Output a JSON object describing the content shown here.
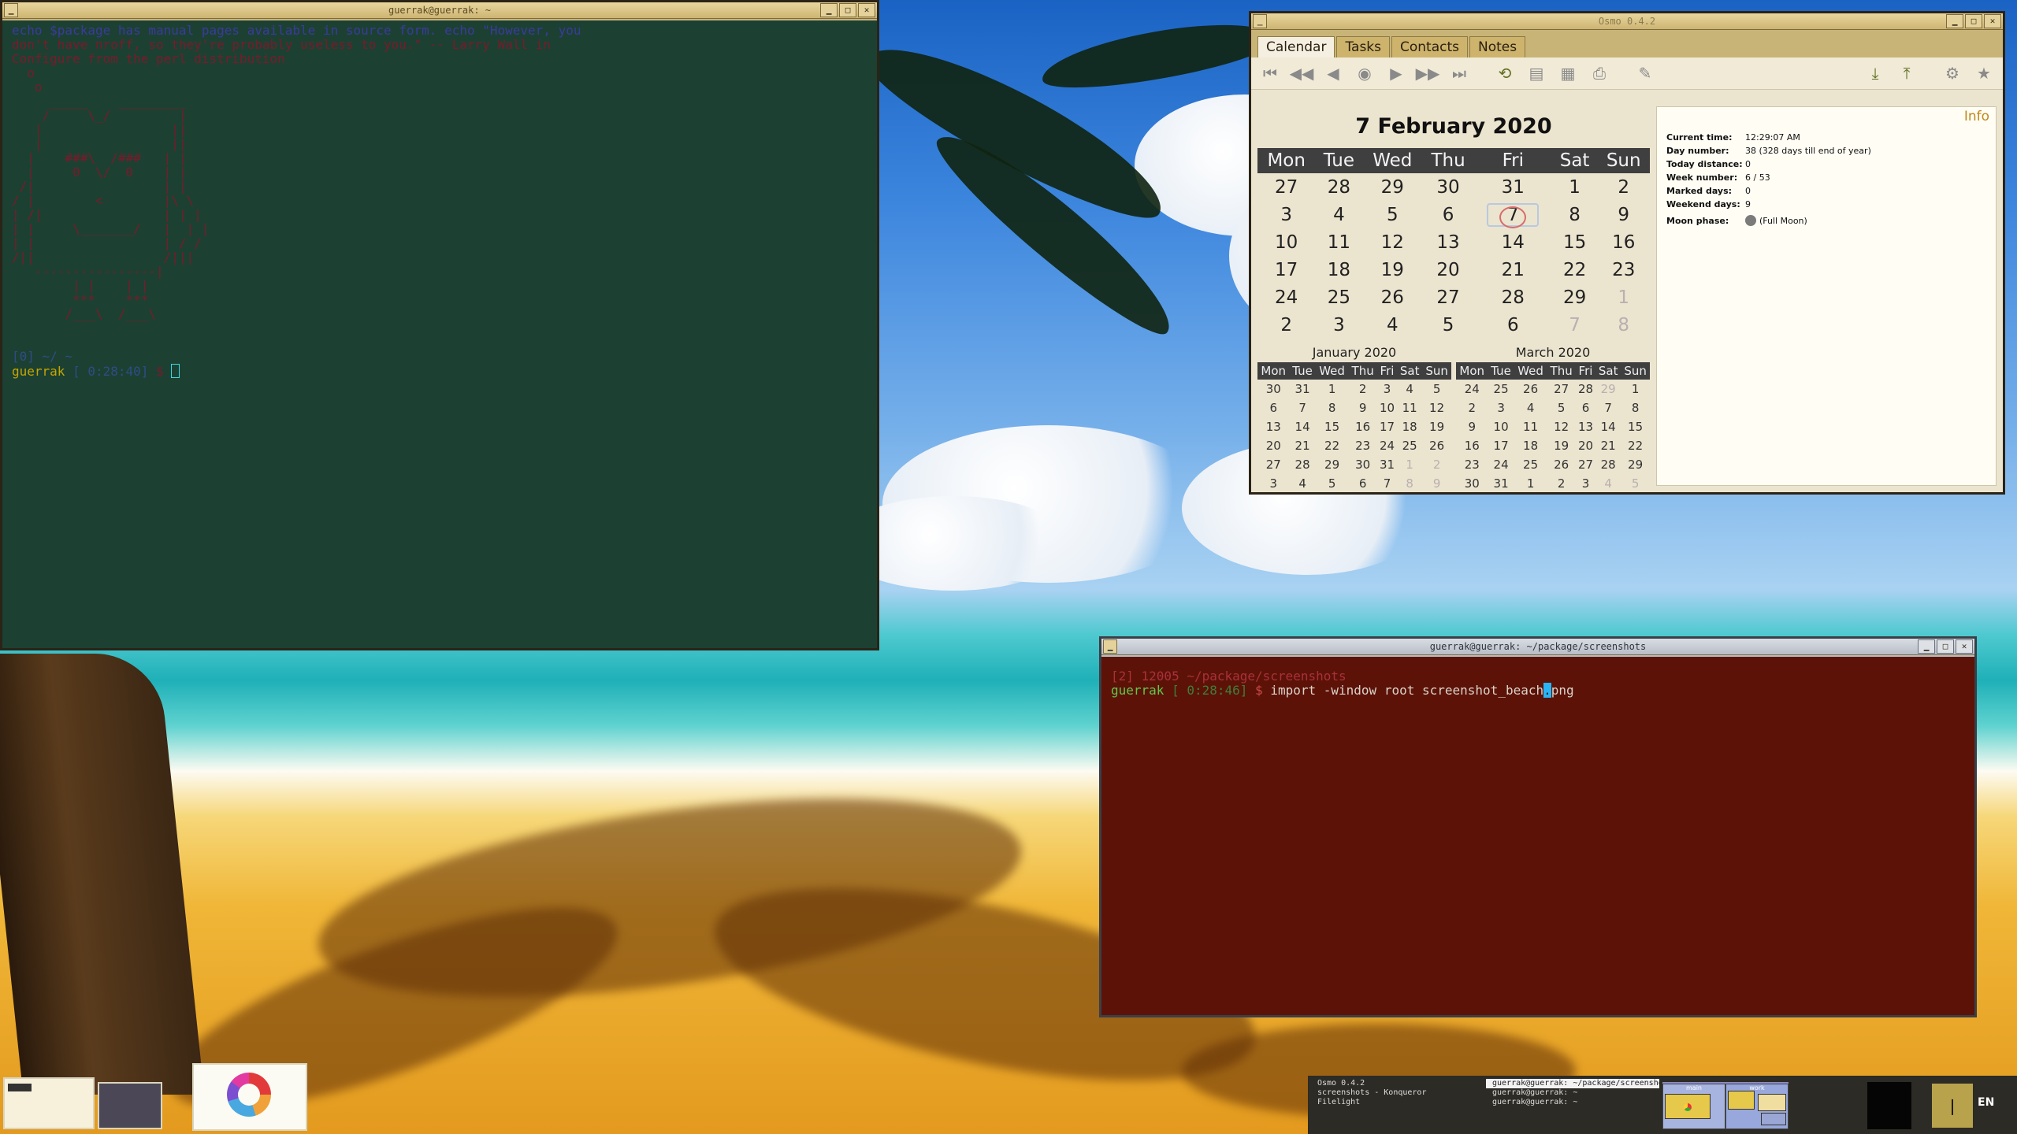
{
  "term1": {
    "title": "guerrak@guerrak: ~",
    "lines": [
      "echo $package has manual pages available in source form. echo \"However, you",
      "don't have nroff, so they're probably useless to you.\" -- Larry Wall in",
      "Configure from the perl distribution"
    ],
    "art": "  o\n   o\n     _____    _________\n    /     \\_/         |\n   |                 ||\n   |                 ||\n  |    ###\\  /###   | |\n  |     0  \\/  0    | |\n /|                 | |\n/ |        <        |\\ \\\n| /|                | | |\n| |     \\_______/   |  | |\n| |                 | / /\n/||                 /|||\n   ----------------|\n        | |    | |\n        ***    ***\n       /___\\  /___\\",
    "status_line": "[0] ~/ ~",
    "prompt_user": "guerrak",
    "prompt_time": "[ 0:28:40]",
    "prompt_sym": "$"
  },
  "term2": {
    "title": "guerrak@guerrak: ~/package/screenshots",
    "status_line": "[2] 12005 ~/package/screenshots",
    "prompt_user": "guerrak",
    "prompt_time": "[ 0:28:46]",
    "prompt_sym": "$",
    "command_before": "import -window root screenshot_beach",
    "cursor_char": ".",
    "command_after": "png"
  },
  "osmo": {
    "title": "Osmo 0.4.2",
    "tabs": [
      "Calendar",
      "Tasks",
      "Contacts",
      "Notes"
    ],
    "active_tab": "Calendar",
    "date_heading": "7 February 2020",
    "weekdays": [
      "Mon",
      "Tue",
      "Wed",
      "Thu",
      "Fri",
      "Sat",
      "Sun"
    ],
    "grid": [
      [
        "27",
        "28",
        "29",
        "30",
        "31",
        "1",
        "2"
      ],
      [
        "3",
        "4",
        "5",
        "6",
        "7",
        "8",
        "9"
      ],
      [
        "10",
        "11",
        "12",
        "13",
        "14",
        "15",
        "16"
      ],
      [
        "17",
        "18",
        "19",
        "20",
        "21",
        "22",
        "23"
      ],
      [
        "24",
        "25",
        "26",
        "27",
        "28",
        "29",
        "1"
      ],
      [
        "2",
        "3",
        "4",
        "5",
        "6",
        "7",
        "8"
      ]
    ],
    "mini_prev": {
      "title": "January 2020",
      "grid": [
        [
          "30",
          "31",
          "1",
          "2",
          "3",
          "4",
          "5"
        ],
        [
          "6",
          "7",
          "8",
          "9",
          "10",
          "11",
          "12"
        ],
        [
          "13",
          "14",
          "15",
          "16",
          "17",
          "18",
          "19"
        ],
        [
          "20",
          "21",
          "22",
          "23",
          "24",
          "25",
          "26"
        ],
        [
          "27",
          "28",
          "29",
          "30",
          "31",
          "1",
          "2"
        ],
        [
          "3",
          "4",
          "5",
          "6",
          "7",
          "8",
          "9"
        ]
      ]
    },
    "mini_next": {
      "title": "March 2020",
      "grid": [
        [
          "24",
          "25",
          "26",
          "27",
          "28",
          "29",
          "1"
        ],
        [
          "2",
          "3",
          "4",
          "5",
          "6",
          "7",
          "8"
        ],
        [
          "9",
          "10",
          "11",
          "12",
          "13",
          "14",
          "15"
        ],
        [
          "16",
          "17",
          "18",
          "19",
          "20",
          "21",
          "22"
        ],
        [
          "23",
          "24",
          "25",
          "26",
          "27",
          "28",
          "29"
        ],
        [
          "30",
          "31",
          "1",
          "2",
          "3",
          "4",
          "5"
        ]
      ]
    },
    "info": {
      "title": "Info",
      "rows": [
        {
          "k": "Current time:",
          "v": "12:29:07 AM"
        },
        {
          "k": "Day number:",
          "v": "38 (328 days till end of year)"
        },
        {
          "k": "Today distance:",
          "v": "0"
        },
        {
          "k": "Week number:",
          "v": "6 / 53"
        },
        {
          "k": "Marked days:",
          "v": "0"
        },
        {
          "k": "Weekend days:",
          "v": "9"
        },
        {
          "k": "Moon phase:",
          "v": "(Full Moon)"
        }
      ]
    }
  },
  "taskbar": {
    "col1": [
      "Osmo 0.4.2",
      "screenshots - Konqueror",
      "Filelight"
    ],
    "col2": [
      "guerrak@guerrak: ~/package/screenshots",
      "guerrak@guerrak: ~",
      "guerrak@guerrak: ~"
    ],
    "pager": [
      "main",
      "work"
    ],
    "lang": "EN"
  },
  "colors": {
    "accent": "#c6a500",
    "weekend": "#8e0d0d",
    "term2_bg": "#5d1208"
  }
}
